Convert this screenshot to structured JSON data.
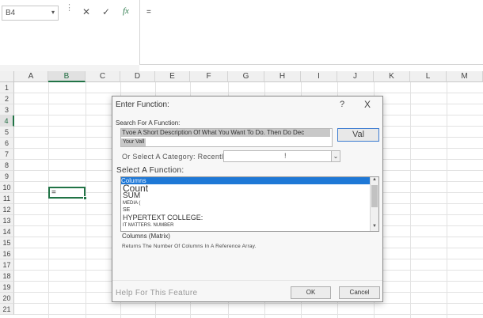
{
  "formula_bar": {
    "name_box": "B4",
    "name_box_dropdown": "▾",
    "dots": "⋮",
    "cancel_glyph": "✕",
    "enter_glyph": "✓",
    "fx_glyph": "fx",
    "content": "="
  },
  "sheet": {
    "columns": [
      "A",
      "B",
      "C",
      "D",
      "E",
      "F",
      "G",
      "H",
      "I",
      "J",
      "K",
      "L",
      "M"
    ],
    "rows": [
      "1",
      "2",
      "3",
      "4",
      "5",
      "6",
      "7",
      "8",
      "9",
      "10",
      "11",
      "12",
      "13",
      "14",
      "15",
      "16",
      "17",
      "18",
      "19",
      "20",
      "21"
    ],
    "selected_column": "B",
    "selected_row": "4",
    "active_cell_value": "="
  },
  "dialog": {
    "title": "Enter Function:",
    "help_glyph": "?",
    "close_glyph": "X",
    "search_label": "Search For A Function:",
    "search_line1": "Tvoe A Short Description Of What You Want To Do. Then Do Dec",
    "search_line2": "Your Vall",
    "search_button": "Val",
    "category_label": "Or Select A Category: Recently Used",
    "category_value": "!",
    "category_dropdown": "⌄",
    "select_label": "Select A Function:",
    "functions": [
      {
        "name": "Columns",
        "selected": true
      },
      {
        "name": "Count",
        "selected": false
      },
      {
        "name": "SUM",
        "selected": false
      },
      {
        "name": "MEDIA (",
        "selected": false
      },
      {
        "name": "SE",
        "selected": false
      },
      {
        "name": "HYPERTEXT COLLEGE:",
        "selected": false
      },
      {
        "name": "IT MATTERS. NUMBER",
        "selected": false
      }
    ],
    "scroll_up": "▲",
    "scroll_down": "▼",
    "signature": "Columns (Matrix)",
    "description": "Returns The Number Of Columns In A Reference Array.",
    "help_link": "Help For This Feature",
    "ok_button": "OK",
    "cancel_button": "Cancel"
  },
  "colors": {
    "excel_green": "#217346",
    "selection_blue": "#1e78d6"
  }
}
